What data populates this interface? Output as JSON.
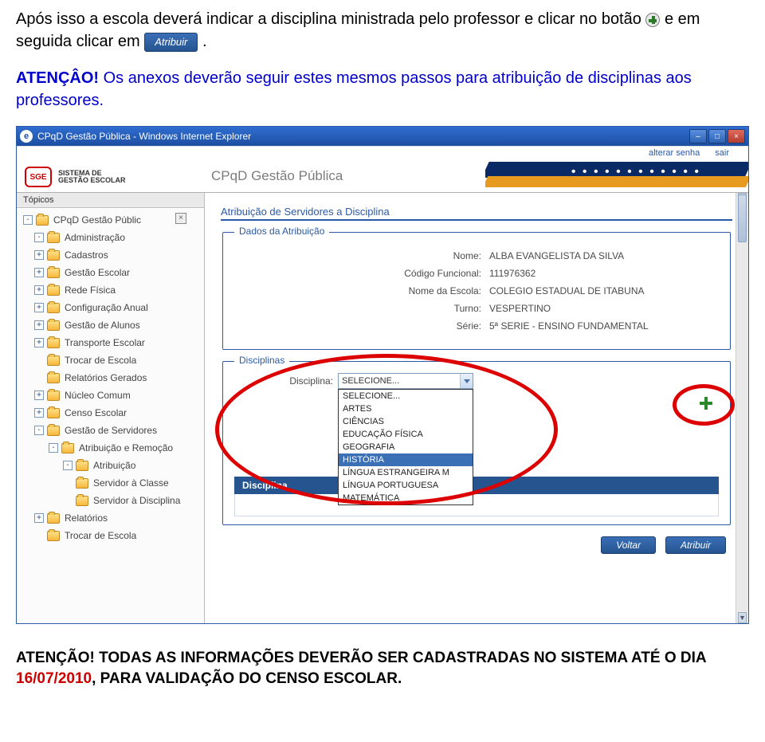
{
  "doc": {
    "para1_a": "Após isso a escola deverá indicar a disciplina ministrada pelo professor e clicar no botão ",
    "para1_b": " e em seguida clicar em ",
    "para1_c": ".",
    "atencao_label": "ATENÇÂO!",
    "atencao_text": " Os anexos deverão seguir estes mesmos passos para atribuição de disciplinas aos professores.",
    "atrib_btn_label": "Atribuir",
    "footer_bold": "ATENÇÃO! TODAS AS INFORMAÇÕES DEVERÃO SER CADASTRADAS NO SISTEMA ATÉ O DIA ",
    "footer_red": "16/07/2010",
    "footer_tail": ", PARA VALIDAÇÃO DO CENSO ESCOLAR."
  },
  "window": {
    "title": "CPqD Gestão Pública - Windows Internet Explorer",
    "min": "–",
    "max": "□",
    "close": "×"
  },
  "header": {
    "sge": "SGE",
    "logo_line1": "SISTEMA DE",
    "logo_line2": "GESTÃO ESCOLAR",
    "banner_title": "CPqD Gestão Pública",
    "link_senha": "alterar senha",
    "link_sair": "sair"
  },
  "sidebar": {
    "topics": "Tópicos",
    "items": [
      {
        "lvl": 0,
        "exp": "-",
        "label": "CPqD Gestão Públic",
        "hasClose": true
      },
      {
        "lvl": 1,
        "exp": "-",
        "label": "Administração"
      },
      {
        "lvl": 1,
        "exp": "+",
        "label": "Cadastros"
      },
      {
        "lvl": 1,
        "exp": "+",
        "label": "Gestão Escolar"
      },
      {
        "lvl": 1,
        "exp": "+",
        "label": "Rede Física"
      },
      {
        "lvl": 1,
        "exp": "+",
        "label": "Configuração Anual"
      },
      {
        "lvl": 1,
        "exp": "+",
        "label": "Gestão de Alunos"
      },
      {
        "lvl": 1,
        "exp": "+",
        "label": "Transporte Escolar"
      },
      {
        "lvl": 1,
        "exp": "",
        "label": "Trocar de Escola"
      },
      {
        "lvl": 1,
        "exp": "",
        "label": "Relatórios Gerados"
      },
      {
        "lvl": 1,
        "exp": "+",
        "label": "Núcleo Comum"
      },
      {
        "lvl": 1,
        "exp": "+",
        "label": "Censo Escolar"
      },
      {
        "lvl": 1,
        "exp": "-",
        "label": "Gestão de Servidores"
      },
      {
        "lvl": 2,
        "exp": "-",
        "label": "Atribuição e Remoção"
      },
      {
        "lvl": 3,
        "exp": "-",
        "label": "Atribuição"
      },
      {
        "lvl": 3,
        "exp": "",
        "label": "Servidor à Classe",
        "leaf": true
      },
      {
        "lvl": 3,
        "exp": "",
        "label": "Servidor à Disciplina",
        "leaf": true
      },
      {
        "lvl": 1,
        "exp": "+",
        "label": "Relatórios"
      },
      {
        "lvl": 1,
        "exp": "",
        "label": "Trocar de Escola"
      }
    ]
  },
  "content": {
    "panel_title": "Atribuição de Servidores a Disciplina",
    "legend_dados": "Dados da Atribuição",
    "legend_disc": "Disciplinas",
    "fields": {
      "nome_l": "Nome:",
      "nome_v": "ALBA EVANGELISTA DA SILVA",
      "cod_l": "Código Funcional:",
      "cod_v": "111976362",
      "esc_l": "Nome da Escola:",
      "esc_v": "COLEGIO ESTADUAL DE ITABUNA",
      "turno_l": "Turno:",
      "turno_v": "VESPERTINO",
      "serie_l": "Série:",
      "serie_v": "5ª SERIE - ENSINO FUNDAMENTAL"
    },
    "disciplina_label": "Disciplina:",
    "select_value": "SELECIONE...",
    "options": [
      "SELECIONE...",
      "ARTES",
      "CIÊNCIAS",
      "EDUCAÇÃO FÍSICA",
      "GEOGRAFIA",
      "HISTÓRIA",
      "LÍNGUA ESTRANGEIRA M",
      "LÍNGUA PORTUGUESA",
      "MATEMÁTICA"
    ],
    "selected_option_index": 5,
    "table_header": "Disciplina",
    "btn_voltar": "Voltar",
    "btn_atribuir": "Atribuir"
  }
}
